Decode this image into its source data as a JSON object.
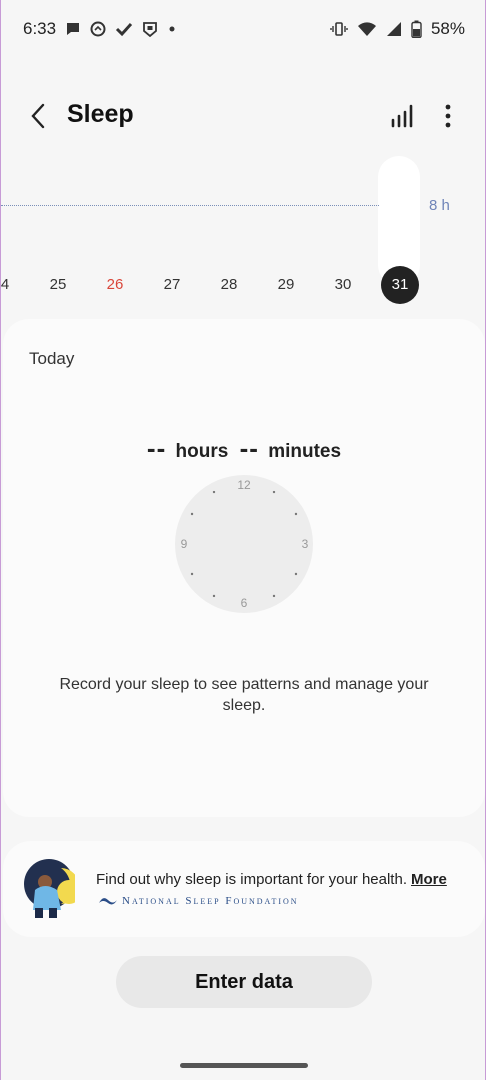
{
  "status_bar": {
    "time": "6:33",
    "battery": "58%",
    "left_icons": [
      "message-icon",
      "messenger-icon",
      "check-icon",
      "shield-icon",
      "dot-icon"
    ],
    "right_icons": [
      "vibrate-icon",
      "wifi-icon",
      "signal-icon",
      "battery-icon"
    ]
  },
  "header": {
    "title": "Sleep"
  },
  "chart": {
    "goal_label": "8 h",
    "days": [
      {
        "label": "4",
        "type": "normal"
      },
      {
        "label": "25",
        "type": "normal"
      },
      {
        "label": "26",
        "type": "sunday"
      },
      {
        "label": "27",
        "type": "normal"
      },
      {
        "label": "28",
        "type": "normal"
      },
      {
        "label": "29",
        "type": "normal"
      },
      {
        "label": "30",
        "type": "normal"
      },
      {
        "label": "31",
        "type": "selected"
      }
    ]
  },
  "today": {
    "label": "Today",
    "hours_value": "--",
    "hours_unit": "hours",
    "minutes_value": "--",
    "minutes_unit": "minutes",
    "clock_labels": {
      "top": "12",
      "right": "3",
      "bottom": "6",
      "left": "9"
    },
    "message": "Record your sleep to see patterns and manage your sleep."
  },
  "info": {
    "text": "Find out why sleep is important for your health.",
    "more": "More",
    "logo_text": "National Sleep Foundation"
  },
  "action": {
    "enter_data": "Enter data"
  },
  "colors": {
    "sunday": "#d9463a",
    "goal": "#6f84b8",
    "selected": "#222222"
  }
}
